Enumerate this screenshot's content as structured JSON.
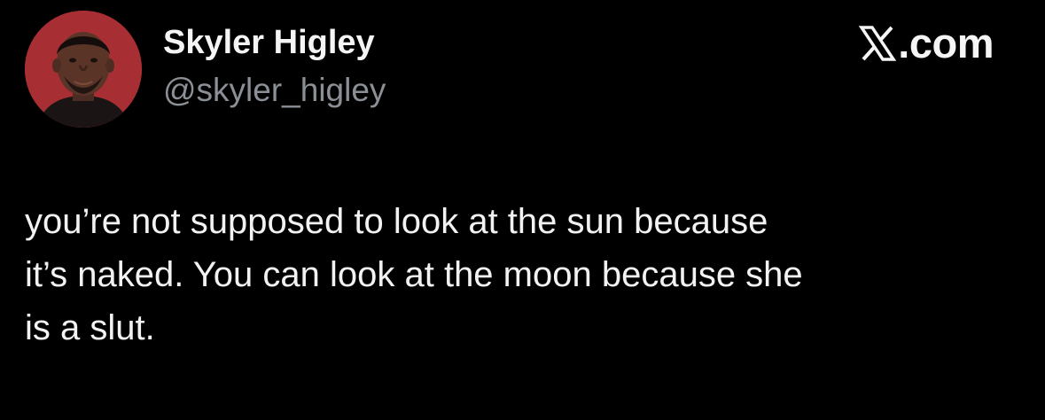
{
  "author": {
    "name": "Skyler Higley",
    "handle": "@skyler_higley",
    "avatar_background": "#a72f34"
  },
  "brand": {
    "icon": "x-logo-icon",
    "text": ".com"
  },
  "tweet": {
    "lines": [
      "you’re not supposed to look at the sun because",
      "it’s naked. You can look at the moon because she",
      "is a slut."
    ]
  },
  "colors": {
    "background": "#000000",
    "name": "#f5f5f5",
    "handle": "#8b9096",
    "body_text": "#f2f2f2"
  }
}
